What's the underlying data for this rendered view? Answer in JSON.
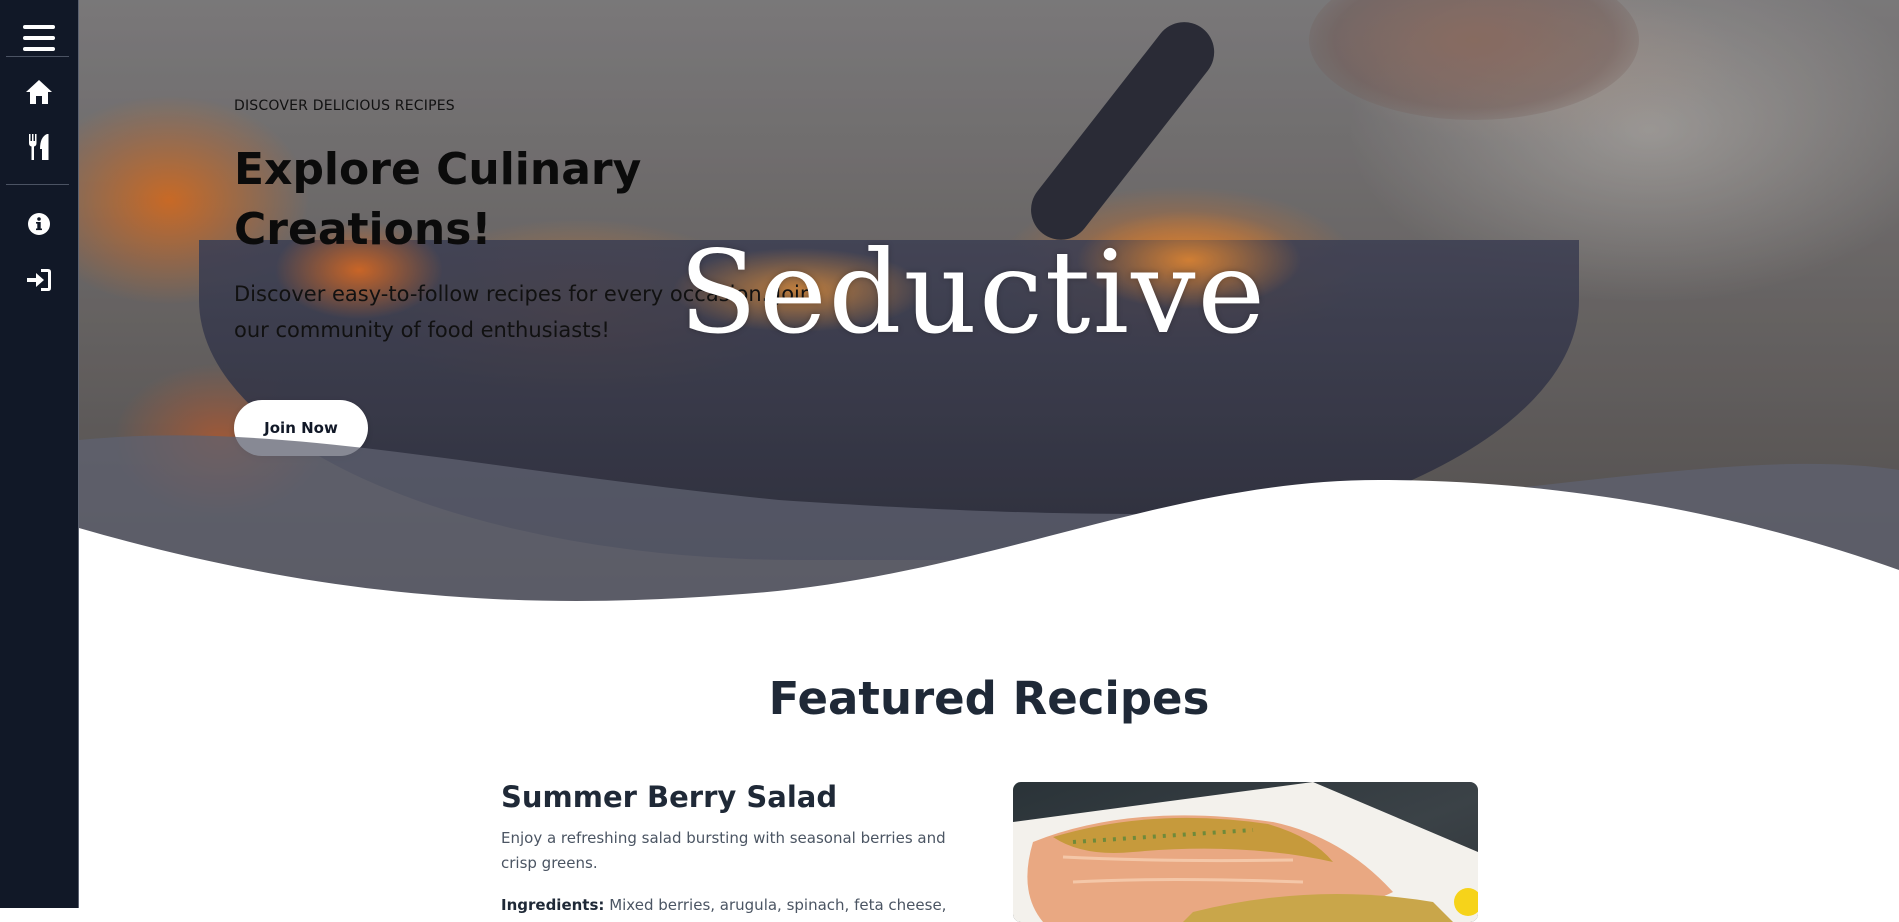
{
  "sidebar": {
    "items": [
      {
        "icon": "hamburger-icon"
      },
      {
        "icon": "home-icon"
      },
      {
        "icon": "utensils-icon"
      },
      {
        "icon": "info-icon"
      },
      {
        "icon": "sign-in-icon"
      }
    ]
  },
  "hero": {
    "eyebrow": "DISCOVER DELICIOUS RECIPES",
    "title": "Explore Culinary Creations!",
    "subtitle": "Discover easy-to-follow recipes for every occasion. Join our community of food enthusiasts!",
    "brand": "Seductive",
    "cta": "Join Now"
  },
  "featured": {
    "title": "Featured Recipes",
    "recipe": {
      "title": "Summer Berry Salad",
      "description": "Enjoy a refreshing salad bursting with seasonal berries and crisp greens.",
      "ingredients_label": "Ingredients:",
      "ingredients": "Mixed berries, arugula, spinach, feta cheese,"
    }
  },
  "colors": {
    "sidebar_bg": "#111827",
    "heading": "#1f2937",
    "body_text": "#4b5563"
  }
}
